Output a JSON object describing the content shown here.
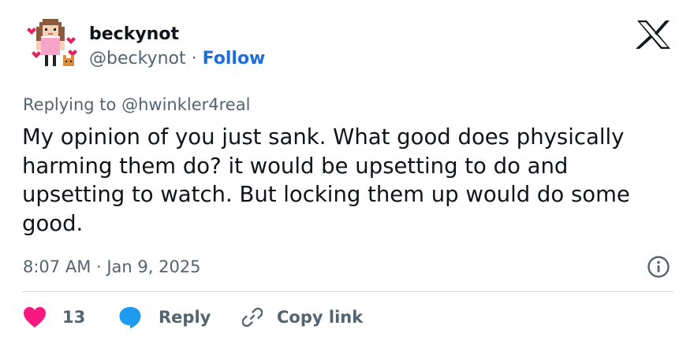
{
  "user": {
    "display_name": "beckynot",
    "handle": "@beckynot",
    "separator": "·",
    "follow_label": "Follow"
  },
  "replying": {
    "prefix": "Replying to",
    "target": "@hwinkler4real"
  },
  "tweet": {
    "text": "My opinion of you just sank. What good does physically harming them do? it would be upsetting to do and upsetting to watch. But locking them up would do some good.",
    "timestamp": "8:07 AM · Jan 9, 2025"
  },
  "actions": {
    "like_count": "13",
    "reply_label": "Reply",
    "copy_link_label": "Copy link"
  },
  "icons": {
    "logo": "x-logo-icon",
    "info": "info-icon",
    "like": "heart-icon",
    "reply": "speech-bubble-icon",
    "copy": "link-icon"
  },
  "colors": {
    "text": "#0f1419",
    "secondary": "#536471",
    "link": "#1d6ed8",
    "heart": "#f91880",
    "reply_bubble": "#1d9bf0",
    "divider": "#cfd9de"
  }
}
